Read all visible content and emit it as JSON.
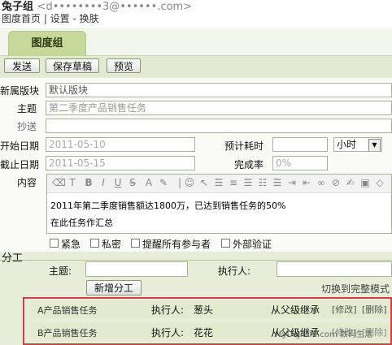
{
  "header": {
    "username": "兔子组",
    "email": "<d••••••••3@••••••.com>",
    "nav": "图度首页 | 设置 - 换肤"
  },
  "tab": {
    "label": "图度组"
  },
  "toolbar": {
    "send": "发送",
    "save_draft": "保存草稿",
    "preview": "预览"
  },
  "form": {
    "block_label": "新属版块",
    "block_value": "默认版块",
    "subject_label": "主题",
    "subject_value": "第二季度产品销售任务",
    "cc_label": "抄送",
    "cc_value": "",
    "start_label": "开始日期",
    "start_value": "2011-05-10",
    "est_label": "预计耗时",
    "est_value": "",
    "unit_value": "小时",
    "deadline_label": "截止日期",
    "deadline_value": "2011-05-15",
    "rate_label": "完成率",
    "rate_value": "0%",
    "content_label": "内容",
    "content_line1": "2011年第二季度销售额达1800万，已达到销售任务的50%",
    "content_line2": "在此任务作汇总"
  },
  "options": {
    "urgent": "紧急",
    "private": "私密",
    "remind_all": "提醒所有参与者",
    "external_verify": "外部验证"
  },
  "division": {
    "label": "分工",
    "subject_label": "主题:",
    "executor_label": "执行人:",
    "add_button": "新增分工",
    "switch_mode": "切换到完整模式"
  },
  "subtasks": [
    {
      "name": "A产品销售任务",
      "executor_label": "执行人:",
      "executor": "葱头",
      "inherit": "从父级继承",
      "edit": "[修改]",
      "delete": "[删除]"
    },
    {
      "name": "B产品销售任务",
      "executor_label": "执行人:",
      "executor": "花花",
      "inherit": "从父级继承",
      "edit": "[修改]",
      "delete": "[删除]"
    }
  ],
  "watermark": "MyDigiLife.com 数码生活"
}
